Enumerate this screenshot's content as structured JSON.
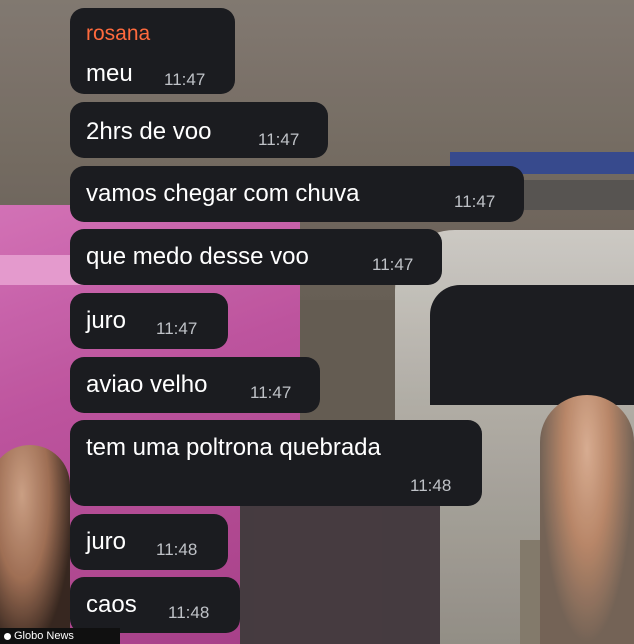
{
  "sender": "rosana",
  "messages": [
    {
      "text": "meu",
      "time": "11:47"
    },
    {
      "text": "2hrs de voo",
      "time": "11:47"
    },
    {
      "text": "vamos chegar com chuva",
      "time": "11:47"
    },
    {
      "text": "que medo desse voo",
      "time": "11:47"
    },
    {
      "text": "juro",
      "time": "11:47"
    },
    {
      "text": "aviao velho",
      "time": "11:47"
    },
    {
      "text": "tem uma poltrona quebrada",
      "time": "11:48"
    },
    {
      "text": "juro",
      "time": "11:48"
    },
    {
      "text": "caos",
      "time": "11:48"
    }
  ],
  "watermark": "Globo News",
  "colors": {
    "bubble": "#1b1c20",
    "sender_name": "#ff6a3d",
    "timestamp": "#bfc2c7"
  }
}
